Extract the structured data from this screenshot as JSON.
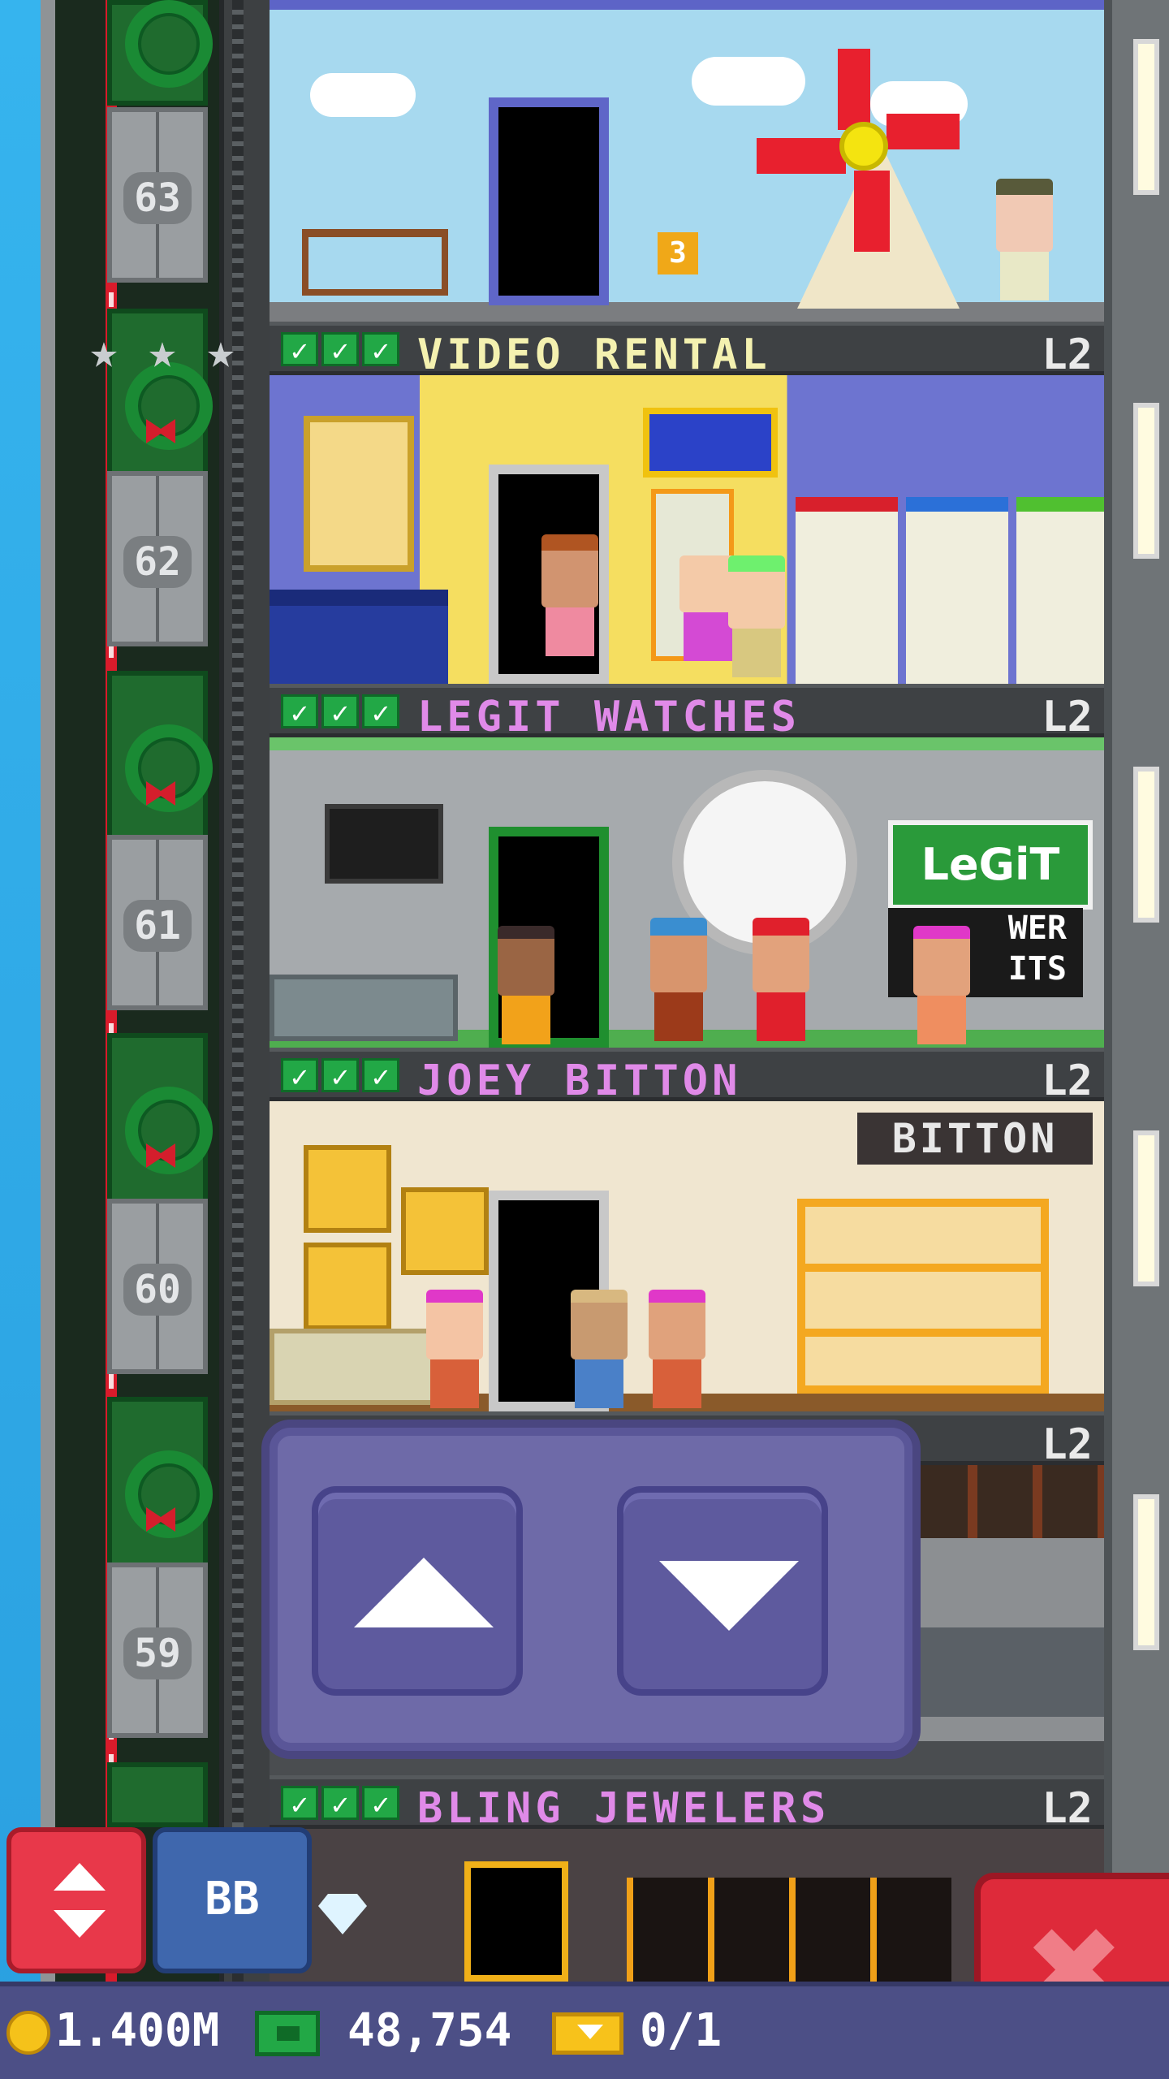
{
  "elevator": {
    "floor_numbers": [
      "63",
      "62",
      "61",
      "60",
      "59"
    ],
    "stars_count": 3
  },
  "floors": [
    {
      "name": "VIDEO RENTAL",
      "level": "L2",
      "name_color": "#f4f1b0",
      "checks": 3
    },
    {
      "name": "LEGIT WATCHES",
      "level": "L2",
      "name_color": "#e08ae8",
      "checks": 3
    },
    {
      "name": "JOEY BITTON",
      "level": "L2",
      "name_color": "#e08ae8",
      "checks": 3
    },
    {
      "name": "",
      "level": "L2",
      "name_color": "#e08ae8",
      "checks": 0
    },
    {
      "name": "BLING JEWELERS",
      "level": "L2",
      "name_color": "#e08ae8",
      "checks": 3
    }
  ],
  "signs": {
    "elevator_badge": "3",
    "legit_logo": "LeGiT",
    "legit_sub": "WER\nITS",
    "bitton_sign": "BITTON"
  },
  "controls": {
    "up_icon": "up-arrow-icon",
    "down_icon": "down-arrow-icon"
  },
  "buttons": {
    "bb_label": "BB"
  },
  "status": {
    "coins": "1.400M",
    "bux": "48,754",
    "tickets": "0/1"
  },
  "colors": {
    "check_green": "#22a846",
    "control_purple": "#6e6aa8",
    "close_red": "#de2a3a"
  }
}
